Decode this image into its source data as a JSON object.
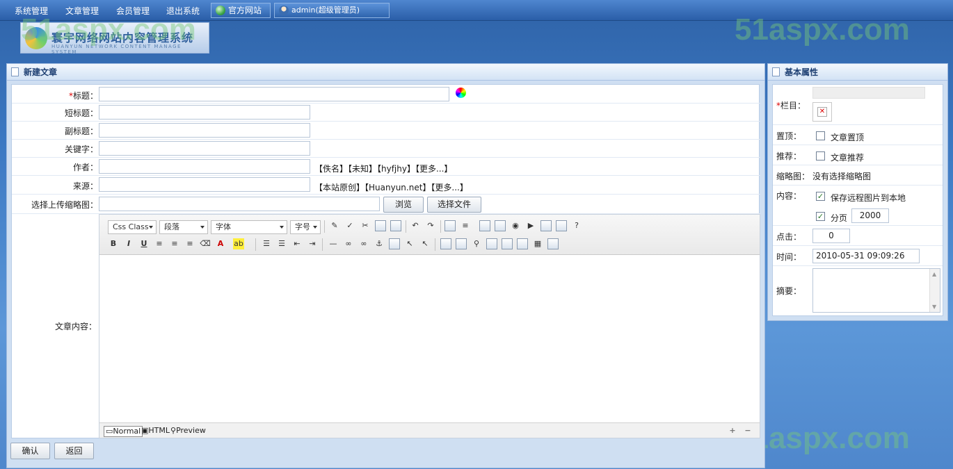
{
  "nav": {
    "items": [
      "系统管理",
      "文章管理",
      "会员管理",
      "退出系统"
    ],
    "official_site": "官方网站",
    "user": "admin(超级管理员)"
  },
  "logo": {
    "title": "寰宇网络网站内容管理系统",
    "subtitle": "HUANYUN NETWORK CONTENT MANAGE SYSTEM"
  },
  "watermark": "51aspx.com",
  "main_panel": {
    "title": "新建文章",
    "fields": {
      "title_label": "标题：",
      "title_required": "*",
      "short_title_label": "短标题：",
      "sub_title_label": "副标题：",
      "keywords_label": "关键字：",
      "author_label": "作者：",
      "author_links": "【佚名】【未知】【hyfjhy】【更多...】",
      "source_label": "来源：",
      "source_links": "【本站原创】【Huanyun.net】【更多...】",
      "thumb_label": "选择上传缩略图：",
      "browse_button": "浏览",
      "choose_file_button": "选择文件",
      "content_label": "文章内容："
    },
    "editor": {
      "css_class": "Css Class",
      "paragraph": "段落",
      "font": "字体",
      "font_size": "字号",
      "mode_normal": "Normal",
      "mode_html": "HTML",
      "mode_preview": "Preview"
    }
  },
  "side_panel": {
    "title": "基本属性",
    "column_required": "*",
    "column_label": "栏目：",
    "top_label": "置顶：",
    "top_option": "文章置顶",
    "recommend_label": "推荐：",
    "recommend_option": "文章推荐",
    "thumb_label": "缩略图：",
    "thumb_value": "没有选择缩略图",
    "content_label": "内容：",
    "save_remote_option": "保存远程图片到本地",
    "paging_option": "分页",
    "paging_value": "2000",
    "clicks_label": "点击：",
    "clicks_value": "0",
    "time_label": "时间：",
    "time_value": "2010-05-31 09:09:26",
    "summary_label": "摘要："
  },
  "buttons": {
    "confirm": "确认",
    "back": "返回"
  }
}
